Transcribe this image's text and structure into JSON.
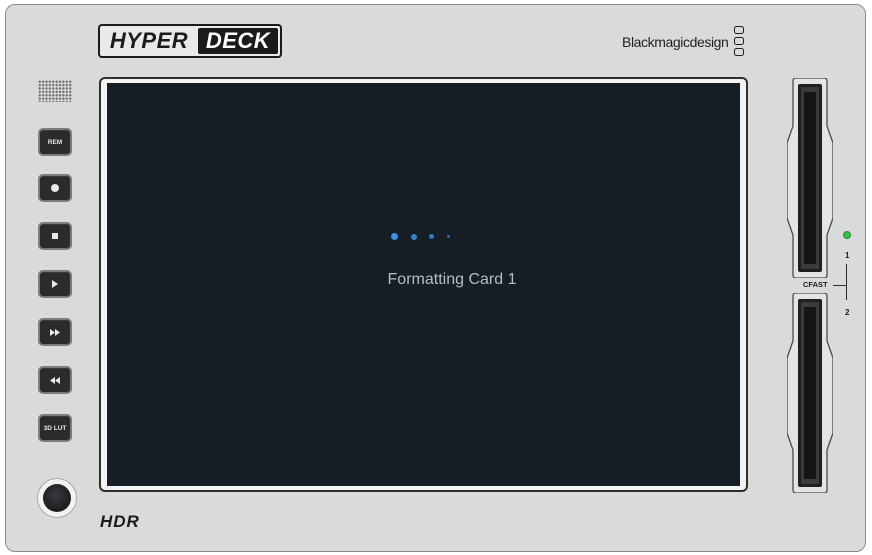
{
  "device": {
    "logo": {
      "part1": "HYPER",
      "part2": "DECK"
    },
    "brand": "Blackmagicdesign",
    "model_badge": "HDR"
  },
  "controls": {
    "rem_label": "REM",
    "lut_label": "3D LUT",
    "record_icon": "record-icon",
    "stop_icon": "stop-icon",
    "play_icon": "play-icon",
    "fast_forward_icon": "fast-forward-icon",
    "rewind_icon": "rewind-icon"
  },
  "screen": {
    "status_text": "Formatting Card 1",
    "spinner_color": "#3c8ee6",
    "background": "#151d25"
  },
  "media": {
    "slot_type": "CFAST",
    "slot1_label": "1",
    "slot2_label": "2",
    "slot1_led_color": "#35c244"
  }
}
